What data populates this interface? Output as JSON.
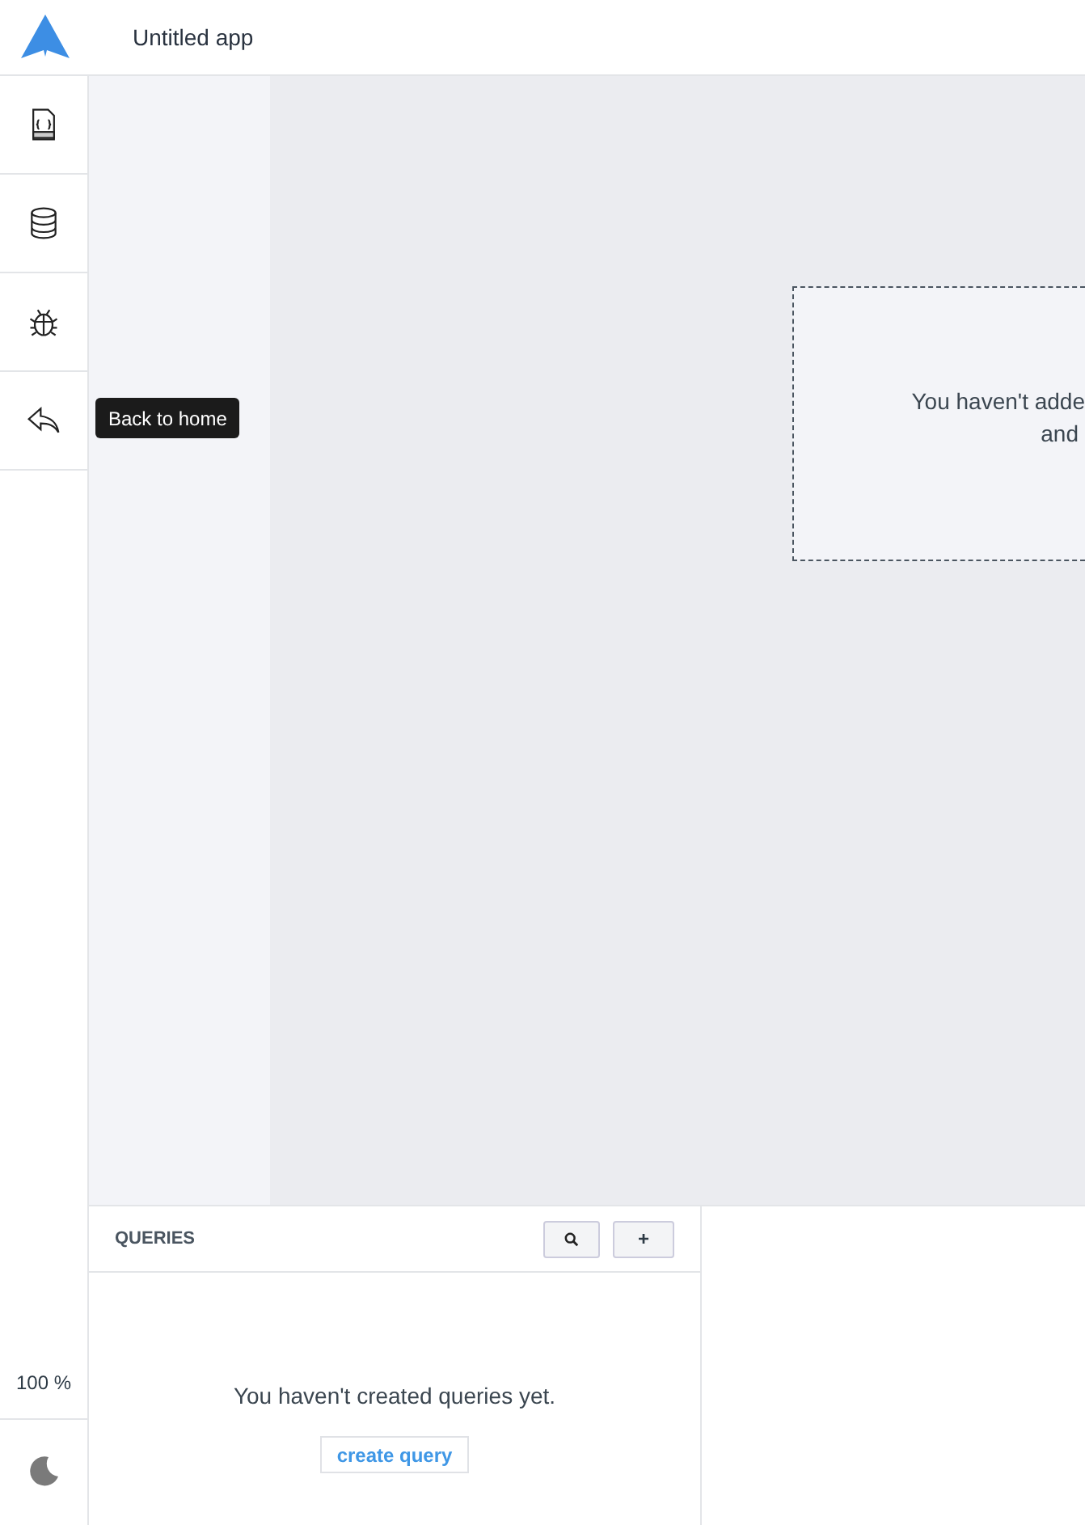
{
  "header": {
    "app_name": "Untitled app"
  },
  "sidebar": {
    "items": [
      {
        "kind": "json"
      },
      {
        "kind": "database"
      },
      {
        "kind": "bug"
      },
      {
        "kind": "back"
      }
    ],
    "tooltip": "Back to home",
    "zoom": "100 %"
  },
  "canvas": {
    "empty_lines": [
      "You haven't adde",
      "and"
    ]
  },
  "queries": {
    "title": "QUERIES",
    "empty_text": "You haven't created queries yet.",
    "create_button": "create query",
    "add_button": "+"
  }
}
